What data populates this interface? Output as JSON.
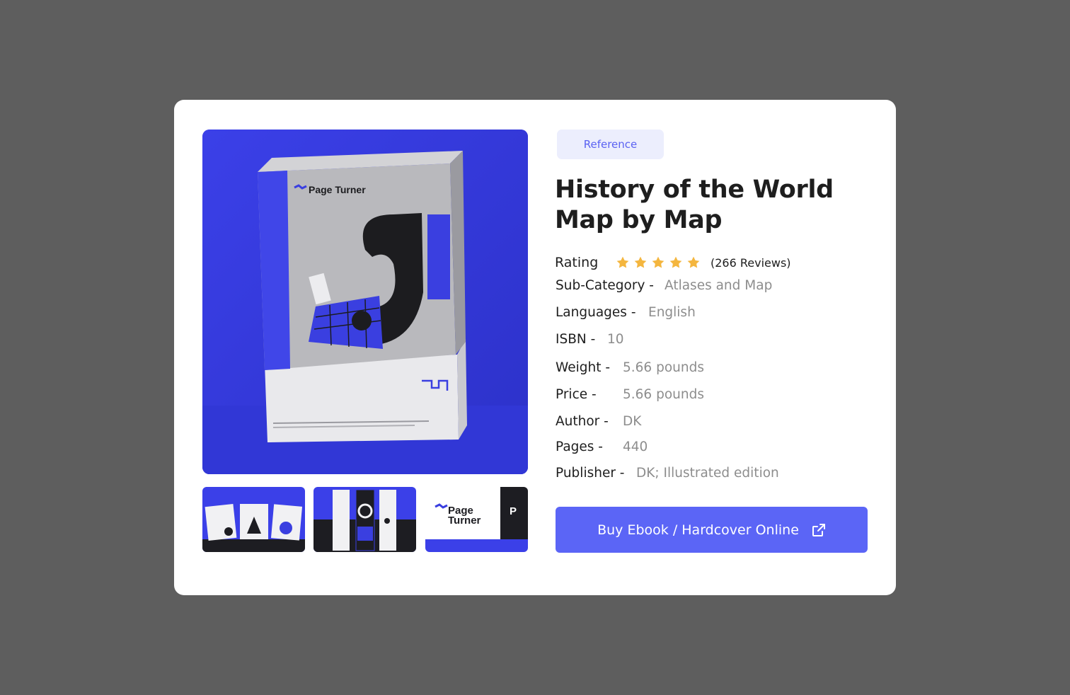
{
  "gallery": {
    "main_image_alt": "Page Turner book box mockup",
    "brand_text": "Page Turner",
    "thumbnails": [
      {
        "name": "Cards mockup"
      },
      {
        "name": "Bookmarks mockup"
      },
      {
        "name": "Logo mockup"
      }
    ]
  },
  "product": {
    "category_tag": "Reference",
    "title": "History of the World Map by Map",
    "rating_label": "Rating",
    "rating_stars": 5,
    "reviews": "(266 Reviews)",
    "specs": {
      "subcategory": {
        "label": "Sub-Category -",
        "value": "Atlases and Map"
      },
      "languages": {
        "label": "Languages -",
        "value": "English"
      },
      "isbn": {
        "label": "ISBN -",
        "value": "10"
      },
      "weight": {
        "label": "Weight -",
        "value": "5.66 pounds"
      },
      "price": {
        "label": "Price -",
        "value": "5.66 pounds"
      },
      "author": {
        "label": "Author -",
        "value": "DK"
      },
      "pages": {
        "label": "Pages -",
        "value": "440"
      },
      "publisher": {
        "label": "Publisher -",
        "value": "DK; Illustrated edition"
      }
    },
    "buy_label": "Buy Ebook / Hardcover Online"
  },
  "colors": {
    "accent": "#5b65f6",
    "tag_bg": "#eceefd",
    "star": "#f4b63f",
    "backdrop": "#5e5e5e",
    "brand_blue": "#3a3fe0"
  }
}
